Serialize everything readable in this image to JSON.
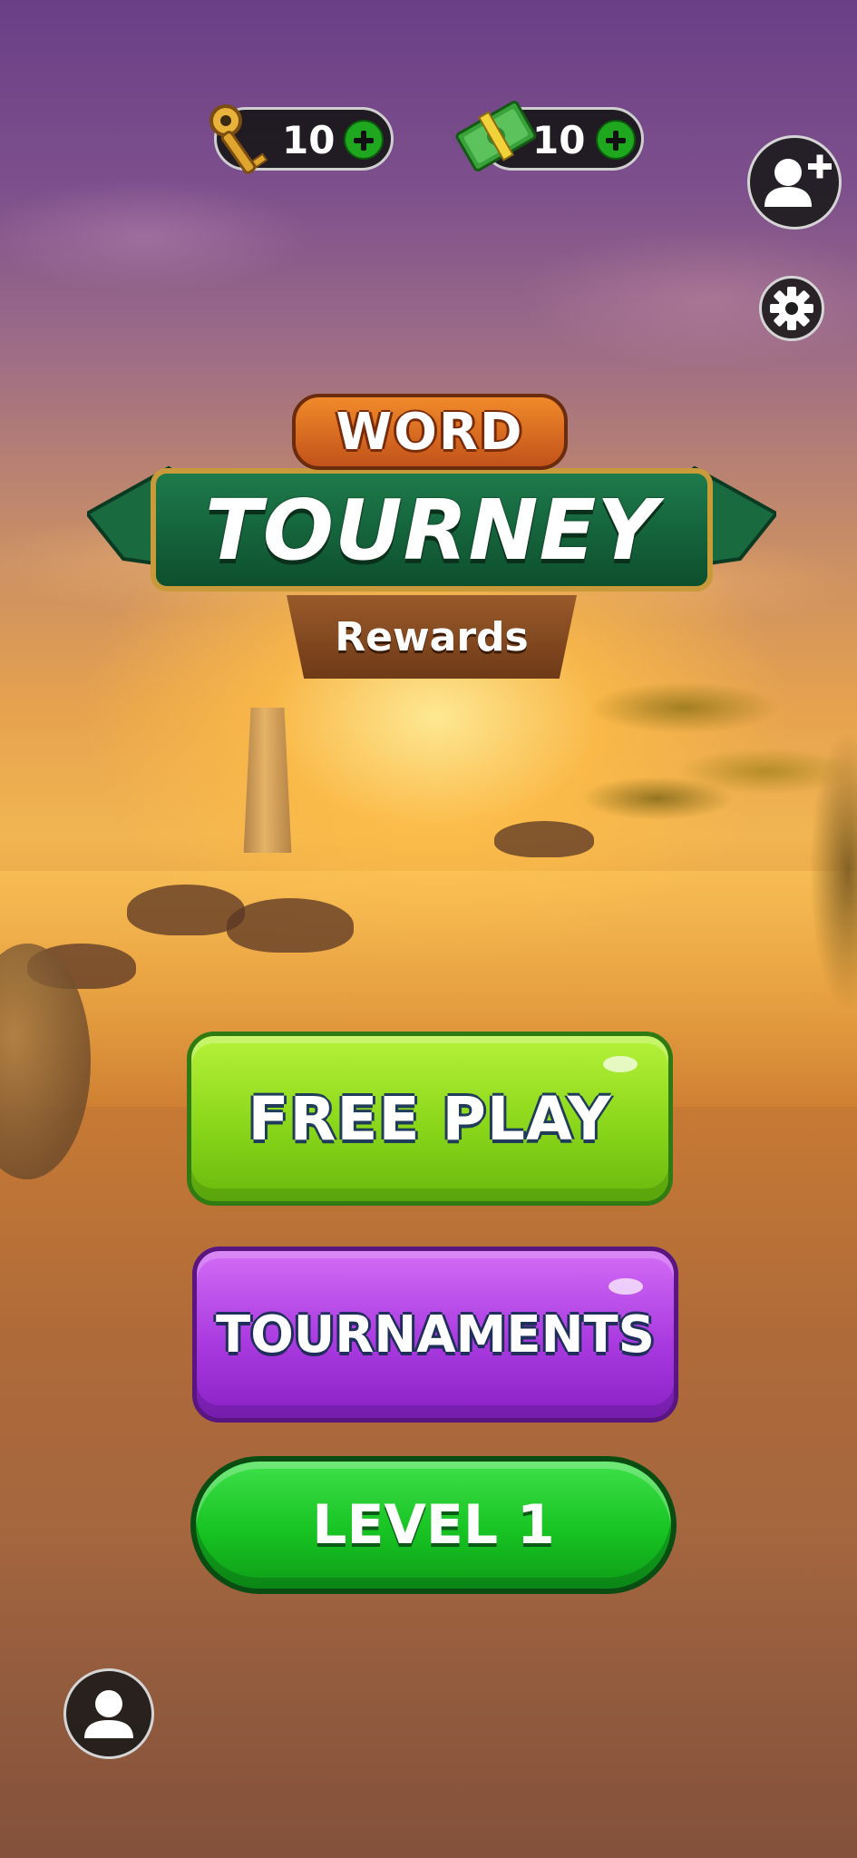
{
  "currencies": {
    "keys": {
      "count": "10",
      "icon": "key-icon",
      "add_icon": "plus-icon"
    },
    "cash": {
      "count": "10",
      "icon": "cash-icon",
      "add_icon": "plus-icon"
    }
  },
  "top_right": {
    "add_friend_icon": "add-friend-icon",
    "settings_icon": "gear-icon"
  },
  "logo": {
    "word": "WORD",
    "title": "TOURNEY",
    "subtitle": "Rewards"
  },
  "menu": {
    "free_play": "FREE PLAY",
    "tournaments": "TOURNAMENTS",
    "level": "LEVEL 1"
  },
  "bottom_left": {
    "profile_icon": "profile-icon"
  },
  "colors": {
    "free_play": "#8ad61a",
    "tournaments": "#a93ae0",
    "level": "#17c322",
    "logo_green": "#0d4f2e",
    "logo_orange": "#e0712a"
  }
}
